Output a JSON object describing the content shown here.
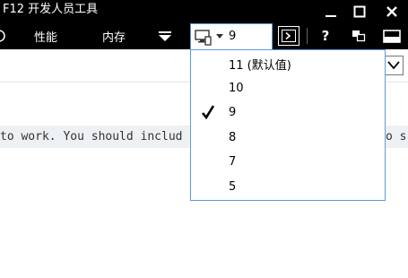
{
  "window": {
    "title": "F12 开发人员工具"
  },
  "toolbar": {
    "tabs": [
      {
        "label": "性能"
      },
      {
        "label": "内存"
      }
    ]
  },
  "doc_mode": {
    "current_value": "9",
    "options": [
      {
        "label": "11 (默认值)",
        "selected": false
      },
      {
        "label": "10",
        "selected": false
      },
      {
        "label": "9",
        "selected": true
      },
      {
        "label": "8",
        "selected": false
      },
      {
        "label": "7",
        "selected": false
      },
      {
        "label": "5",
        "selected": false
      }
    ]
  },
  "console": {
    "line_start": "to work. You should includ",
    "line_end": "o s"
  },
  "colors": {
    "accent_border": "#5b9bd5",
    "toolbar_bg": "#000000"
  }
}
